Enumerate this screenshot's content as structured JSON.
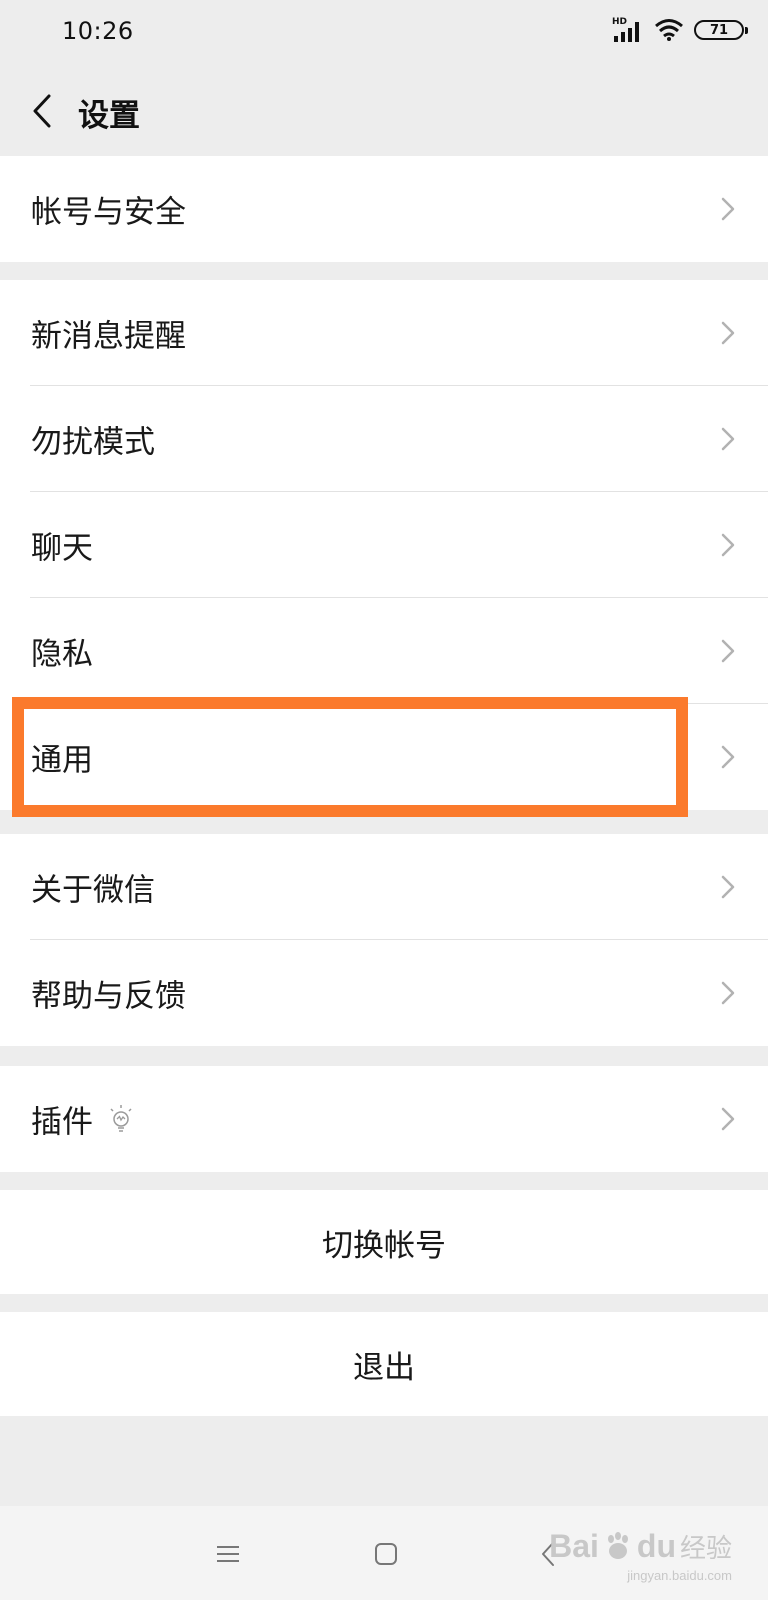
{
  "status_bar": {
    "time": "10:26",
    "network_label": "HD",
    "battery_level": "71",
    "icons": [
      "signal-icon",
      "wifi-icon",
      "battery-icon"
    ]
  },
  "header": {
    "title": "设置",
    "back_icon": "chevron-left-icon"
  },
  "groups": {
    "account": {
      "items": [
        {
          "label": "帐号与安全"
        }
      ]
    },
    "main": {
      "items": [
        {
          "label": "新消息提醒"
        },
        {
          "label": "勿扰模式"
        },
        {
          "label": "聊天"
        },
        {
          "label": "隐私"
        },
        {
          "label": "通用"
        }
      ]
    },
    "about": {
      "items": [
        {
          "label": "关于微信"
        },
        {
          "label": "帮助与反馈"
        }
      ]
    },
    "plugins": {
      "items": [
        {
          "label": "插件",
          "icon": "lightbulb-icon"
        }
      ]
    }
  },
  "actions": {
    "switch_account": "切换帐号",
    "logout": "退出"
  },
  "highlight": {
    "target": "通用",
    "color": "#fb7a2c"
  },
  "nav_bar": {
    "icons": [
      "menu-icon",
      "home-icon",
      "back-icon"
    ]
  },
  "watermark": {
    "brand": "Bai",
    "brand2": "du",
    "suffix": "经验",
    "domain": "jingyan.baidu.com"
  },
  "colors": {
    "background": "#ededed",
    "surface": "#ffffff",
    "divider": "#e2e2e2",
    "accent": "#fb7a2c"
  }
}
